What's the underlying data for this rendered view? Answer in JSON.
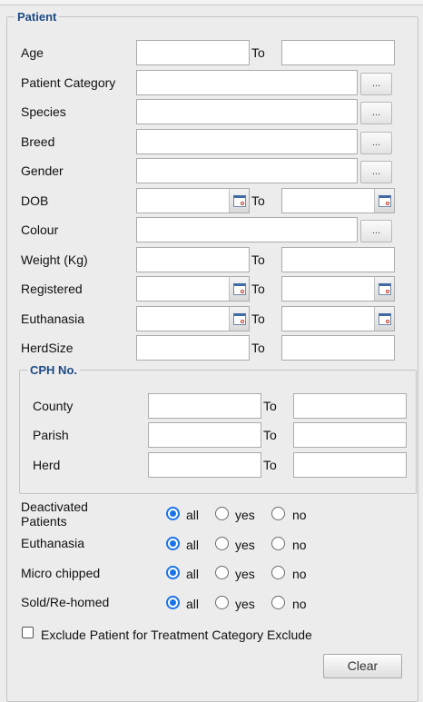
{
  "patient": {
    "legend": "Patient",
    "to_label": "To",
    "browse_label": "...",
    "age": {
      "label": "Age",
      "from": "",
      "to": ""
    },
    "patient_category": {
      "label": "Patient Category",
      "value": ""
    },
    "species": {
      "label": "Species",
      "value": ""
    },
    "breed": {
      "label": "Breed",
      "value": ""
    },
    "gender": {
      "label": "Gender",
      "value": ""
    },
    "dob": {
      "label": "DOB",
      "from": "",
      "to": ""
    },
    "colour": {
      "label": "Colour",
      "value": ""
    },
    "weight": {
      "label": "Weight (Kg)",
      "from": "",
      "to": ""
    },
    "registered": {
      "label": "Registered",
      "from": "",
      "to": ""
    },
    "euthanasia_date": {
      "label": "Euthanasia",
      "from": "",
      "to": ""
    },
    "herd_size": {
      "label": "HerdSize",
      "from": "",
      "to": ""
    }
  },
  "cph": {
    "legend": "CPH No.",
    "county": {
      "label": "County",
      "from": "",
      "to": ""
    },
    "parish": {
      "label": "Parish",
      "from": "",
      "to": ""
    },
    "herd": {
      "label": "Herd",
      "from": "",
      "to": ""
    }
  },
  "options": {
    "all": "all",
    "yes": "yes",
    "no": "no",
    "deactivated": {
      "label": "Deactivated\nPatients",
      "selected": "all"
    },
    "euthanasia": {
      "label": "Euthanasia",
      "selected": "all"
    },
    "micro_chipped": {
      "label": "Micro chipped",
      "selected": "all"
    },
    "sold_rehomed": {
      "label": "Sold/Re-homed",
      "selected": "all"
    }
  },
  "exclude": {
    "label": "Exclude Patient for Treatment Category Exclude",
    "checked": false
  },
  "clear_button": "Clear",
  "icons": {
    "browse": "ellipsis-button",
    "calendar": "calendar-icon",
    "radio_selected_color": "#1a73e8"
  }
}
